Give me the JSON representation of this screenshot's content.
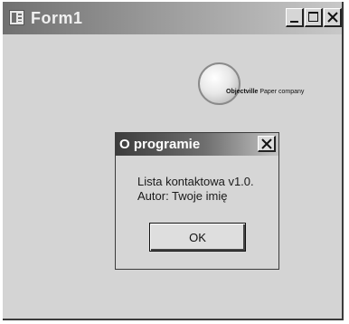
{
  "window": {
    "title": "Form1",
    "icon": "form-app-icon"
  },
  "logo": {
    "icon": "globe-logo",
    "text_bold": "Objectville",
    "text_rest": " Paper company"
  },
  "dialog": {
    "title": "O programie",
    "lines": [
      "Lista kontaktowa v1.0.",
      "Autor: Twoje imię"
    ],
    "ok_label": "OK"
  }
}
